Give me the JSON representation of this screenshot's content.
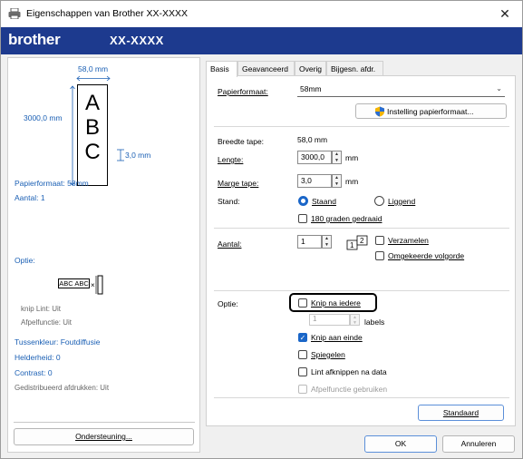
{
  "window": {
    "title": "Eigenschappen van Brother XX-XXXX",
    "close_glyph": "✕"
  },
  "banner": {
    "logo": "brother",
    "model": "XX-XXXX"
  },
  "preview": {
    "width_label": "58,0 mm",
    "length_label": "3000,0 mm",
    "margin_label": "3,0 mm",
    "letters": [
      "A",
      "B",
      "C"
    ],
    "paper_format": "Papierformaat: 58mm",
    "count": "Aantal: 1",
    "option_header": "Optie:",
    "option_sample": "ABC ABC",
    "cut_line": "knip Lint: Uit",
    "peel_function": "Afpelfunctie: Uit",
    "halftone": "Tussenkleur: Foutdiffusie",
    "brightness": "Helderheid:   0",
    "contrast": "Contrast:   0",
    "distributed": "Gedistribueerd afdrukken: Uit",
    "support_button": "Ondersteuning..."
  },
  "tabs": [
    "Basis",
    "Geavanceerd",
    "Overig",
    "Bijgesn. afdr."
  ],
  "basis": {
    "paper_format_label": "Papierformaat:",
    "paper_format_value": "58mm",
    "paper_settings_button": "Instelling papierformaat...",
    "tape_width_label": "Breedte tape:",
    "tape_width_value": "58,0 mm",
    "length_label": "Lengte:",
    "length_value": "3000,0",
    "length_unit": "mm",
    "margin_label": "Marge tape:",
    "margin_value": "3,0",
    "margin_unit": "mm",
    "orientation_label": "Stand:",
    "portrait": "Staand",
    "landscape": "Liggend",
    "rotate180": "180 graden gedraaid",
    "count_label": "Aantal:",
    "count_value": "1",
    "collate": "Verzamelen",
    "reverse_order": "Omgekeerde volgorde",
    "option_label": "Optie:",
    "cut_every": "Knip na iedere",
    "cut_every_value": "1",
    "labels_suffix": "labels",
    "cut_at_end": "Knip aan einde",
    "mirror": "Spiegelen",
    "cut_tape_data": "Lint afknippen na data",
    "use_peel": "Afpelfunctie gebruiken",
    "default_button": "Standaard"
  },
  "footer": {
    "ok": "OK",
    "cancel": "Annuleren"
  }
}
